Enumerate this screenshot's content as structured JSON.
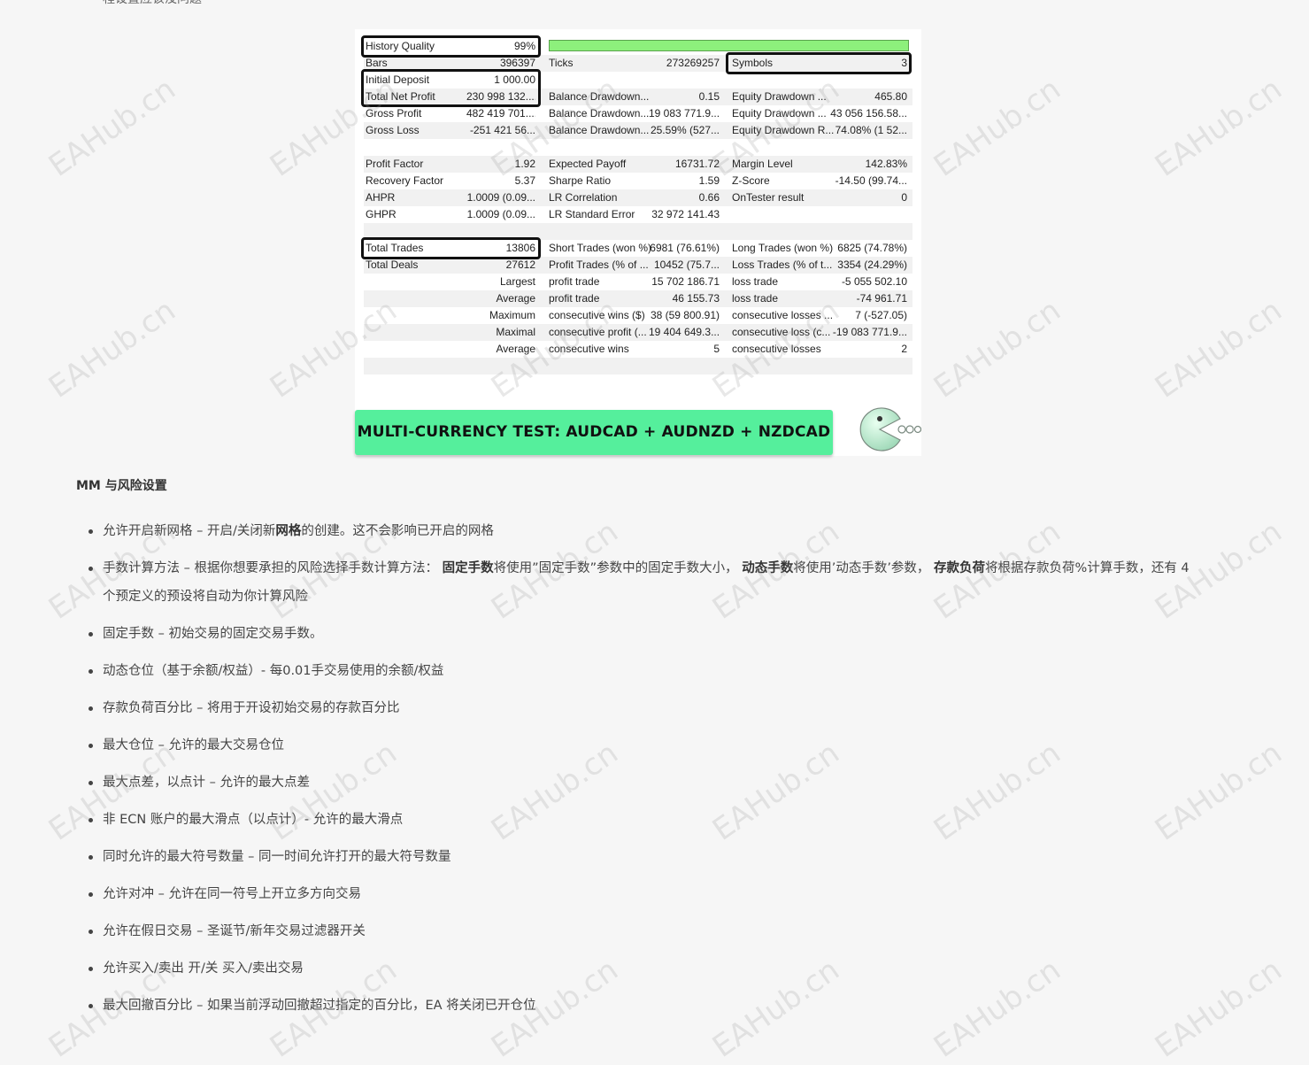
{
  "page": {
    "top_fragment": "程设置应该没问题"
  },
  "report": {
    "rows": [
      {
        "c1": "History Quality",
        "c2": "99%",
        "c3": "",
        "c4": "",
        "c5": "",
        "c6": ""
      },
      {
        "c1": "Bars",
        "c2": "396397",
        "c3": "Ticks",
        "c4": "273269257",
        "c5": "Symbols",
        "c6": "3"
      },
      {
        "c1": "Initial Deposit",
        "c2": "1 000.00",
        "c3": "",
        "c4": "",
        "c5": "",
        "c6": ""
      },
      {
        "c1": "Total Net Profit",
        "c2": "230 998 132....",
        "c3": "Balance Drawdown...",
        "c4": "0.15",
        "c5": "Equity Drawdown ...",
        "c6": "465.80"
      },
      {
        "c1": "Gross Profit",
        "c2": "482 419 701....",
        "c3": "Balance Drawdown...",
        "c4": "19 083 771.9...",
        "c5": "Equity Drawdown ...",
        "c6": "43 056 156.58..."
      },
      {
        "c1": "Gross Loss",
        "c2": "-251 421 56...",
        "c3": "Balance Drawdown...",
        "c4": "25.59% (527...",
        "c5": "Equity Drawdown R...",
        "c6": "74.08% (1 52..."
      },
      {
        "c1": "",
        "c2": "",
        "c3": "",
        "c4": "",
        "c5": "",
        "c6": ""
      },
      {
        "c1": "Profit Factor",
        "c2": "1.92",
        "c3": "Expected Payoff",
        "c4": "16731.72",
        "c5": "Margin Level",
        "c6": "142.83%"
      },
      {
        "c1": "Recovery Factor",
        "c2": "5.37",
        "c3": "Sharpe Ratio",
        "c4": "1.59",
        "c5": "Z-Score",
        "c6": "-14.50 (99.74..."
      },
      {
        "c1": "AHPR",
        "c2": "1.0009 (0.09...",
        "c3": "LR Correlation",
        "c4": "0.66",
        "c5": "OnTester result",
        "c6": "0"
      },
      {
        "c1": "GHPR",
        "c2": "1.0009 (0.09...",
        "c3": "LR Standard Error",
        "c4": "32 972 141.43",
        "c5": "",
        "c6": ""
      },
      {
        "c1": "",
        "c2": "",
        "c3": "",
        "c4": "",
        "c5": "",
        "c6": ""
      },
      {
        "c1": "Total Trades",
        "c2": "13806",
        "c3": "Short Trades (won %)",
        "c4": "6981 (76.61%)",
        "c5": "Long Trades (won %)",
        "c6": "6825 (74.78%)"
      },
      {
        "c1": "Total Deals",
        "c2": "27612",
        "c3": "Profit Trades (% of ...",
        "c4": "10452 (75.7...",
        "c5": "Loss Trades (% of t...",
        "c6": "3354 (24.29%)"
      },
      {
        "c1r": "Largest",
        "c3": "profit trade",
        "c4": "15 702 186.71",
        "c5": "loss trade",
        "c6": "-5 055 502.10"
      },
      {
        "c1r": "Average",
        "c3": "profit trade",
        "c4": "46 155.73",
        "c5": "loss trade",
        "c6": "-74 961.71"
      },
      {
        "c1r": "Maximum",
        "c3": "consecutive wins ($)",
        "c4": "38 (59 800.91)",
        "c5": "consecutive losses ...",
        "c6": "7 (-527.05)"
      },
      {
        "c1r": "Maximal",
        "c3": "consecutive profit (...",
        "c4": "19 404 649.3...",
        "c5": "consecutive loss (c...",
        "c6": "-19 083 771.9..."
      },
      {
        "c1r": "Average",
        "c3": "consecutive wins",
        "c4": "5",
        "c5": "consecutive losses",
        "c6": "2"
      },
      {
        "c1": "",
        "c2": "",
        "c3": "",
        "c4": "",
        "c5": "",
        "c6": ""
      }
    ],
    "banner_text": "MULTI-CURRENCY TEST: AUDCAD + AUDNZD + NZDCAD"
  },
  "section": {
    "heading": "MM 与风险设置"
  },
  "bullets": [
    {
      "parts": [
        {
          "t": "允许开启新网格 – 开启/关闭新"
        },
        {
          "t": "网格",
          "b": true
        },
        {
          "t": "的创建。这不会影响已开启的网格"
        }
      ]
    },
    {
      "parts": [
        {
          "t": "手数计算方法 – 根据你想要承担的风险选择手数计算方法： "
        },
        {
          "t": "固定手数",
          "b": true
        },
        {
          "t": "将使用”固定手数”参数中的固定手数大小， "
        },
        {
          "t": "动态手数",
          "b": true
        },
        {
          "t": "将使用’动态手数’参数， "
        },
        {
          "t": "存款负荷",
          "b": true
        },
        {
          "t": "将根据存款负荷%计算手数，还有 4 个预定义的预设将自动为你计算风险"
        }
      ]
    },
    {
      "parts": [
        {
          "t": "固定手数 – 初始交易的固定交易手数。"
        }
      ]
    },
    {
      "parts": [
        {
          "t": "动态仓位（基于余额/权益）- 每0.01手交易使用的余额/权益"
        }
      ]
    },
    {
      "parts": [
        {
          "t": "存款负荷百分比 – 将用于开设初始交易的存款百分比"
        }
      ]
    },
    {
      "parts": [
        {
          "t": "最大仓位 – 允许的最大交易仓位"
        }
      ]
    },
    {
      "parts": [
        {
          "t": "最大点差，以点计 – 允许的最大点差"
        }
      ]
    },
    {
      "parts": [
        {
          "t": "非 ECN 账户的最大滑点（以点计）- 允许的最大滑点"
        }
      ]
    },
    {
      "parts": [
        {
          "t": "同时允许的最大符号数量 – 同一时间允许打开的最大符号数量"
        }
      ]
    },
    {
      "parts": [
        {
          "t": "允许对冲 – 允许在同一符号上开立多方向交易"
        }
      ]
    },
    {
      "parts": [
        {
          "t": "允许在假日交易 – 圣诞节/新年交易过滤器开关"
        }
      ]
    },
    {
      "parts": [
        {
          "t": "允许买入/卖出 开/关 买入/卖出交易"
        }
      ]
    },
    {
      "parts": [
        {
          "t": "最大回撤百分比 – 如果当前浮动回撤超过指定的百分比，EA 将关闭已开仓位"
        }
      ]
    }
  ],
  "watermark": {
    "text": "EAHub.cn"
  }
}
